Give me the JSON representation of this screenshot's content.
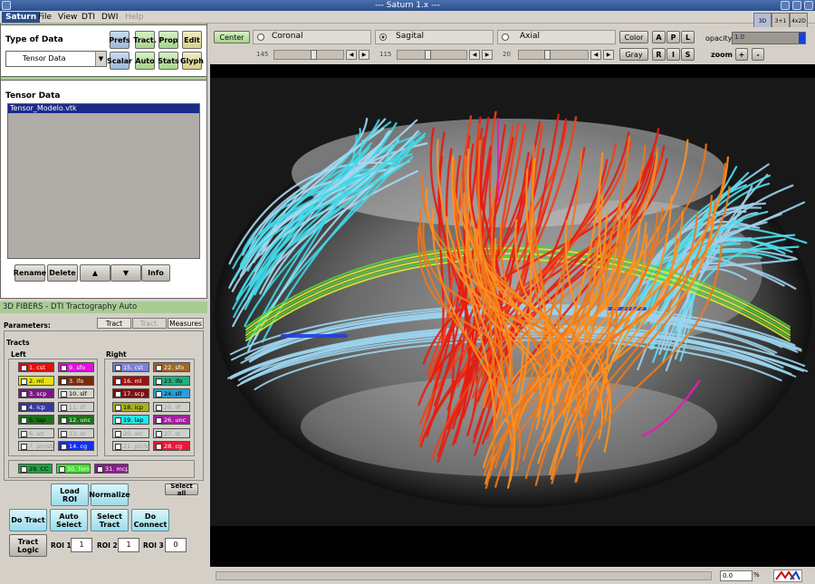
{
  "window": {
    "title": "--- Saturn 1.x ---"
  },
  "menu": [
    "Saturn",
    "File",
    "View",
    "DTI",
    "DWI",
    "Help"
  ],
  "view_buttons": [
    "3D",
    "3+1",
    "4x2D"
  ],
  "type_of_data": {
    "title": "Type of Data",
    "select_value": "Tensor Data",
    "buttons": [
      "Prefs",
      "Tract.",
      "Prop",
      "Edit",
      "Scalar",
      "Auto",
      "Stats",
      "Glyph"
    ]
  },
  "tensor_data": {
    "title": "Tensor Data",
    "items": [
      "Tensor_Modelo.vtk"
    ],
    "buttons": [
      "Rename",
      "Delete",
      "▲",
      "▼",
      "Info"
    ]
  },
  "fibers": {
    "header": "3D FIBERS - DTI Tractography Auto",
    "params_label": "Parameters:",
    "tabs": [
      "Tract",
      "Tract. Auto",
      "Measures"
    ],
    "tracts_label": "Tracts",
    "left_label": "Left",
    "right_label": "Right",
    "left_tracts": [
      {
        "label": "1. cst",
        "color": "#e01010",
        "text": "#fff"
      },
      {
        "label": "9. sfo",
        "color": "#e010e0",
        "text": "#fff"
      },
      {
        "label": "2. ml",
        "color": "#e8e010",
        "text": "#000"
      },
      {
        "label": "3. ifo",
        "color": "#7a2808",
        "text": "#fff"
      },
      {
        "label": "3. scp",
        "color": "#7a1880",
        "text": "#fff"
      },
      {
        "label": "10. slf",
        "color": "#d4d4c8",
        "text": "#000"
      },
      {
        "label": "4. icp",
        "color": "#3838a0",
        "text": "#fff"
      },
      {
        "label": "11. ilf",
        "color": "#d0d0cc",
        "text": "#999"
      },
      {
        "label": "5. lap",
        "color": "#1c7018",
        "text": "#000"
      },
      {
        "label": "12. unc",
        "color": "#1c7018",
        "text": "#fff"
      },
      {
        "label": "6. atr",
        "color": "#d0d0cc",
        "text": "#999"
      },
      {
        "label": "13. st",
        "color": "#d0d0cc",
        "text": "#999"
      },
      {
        "label": "7. ptr/str",
        "color": "#d0d0cc",
        "text": "#999"
      },
      {
        "label": "14. cg",
        "color": "#1030f0",
        "text": "#fff"
      }
    ],
    "right_tracts": [
      {
        "label": "15. cst",
        "color": "#7a82d8",
        "text": "#fff"
      },
      {
        "label": "22. sfo",
        "color": "#a06828",
        "text": "#fff"
      },
      {
        "label": "16. ml",
        "color": "#a01010",
        "text": "#fff"
      },
      {
        "label": "23. ifo",
        "color": "#20b080",
        "text": "#000"
      },
      {
        "label": "17. scp",
        "color": "#781010",
        "text": "#fff"
      },
      {
        "label": "24. slf",
        "color": "#28a0d8",
        "text": "#000"
      },
      {
        "label": "18. icp",
        "color": "#a8b020",
        "text": "#000"
      },
      {
        "label": "25. ilf",
        "color": "#d0d0cc",
        "text": "#999"
      },
      {
        "label": "19. lap",
        "color": "#20e8e8",
        "text": "#000"
      },
      {
        "label": "26. unc",
        "color": "#a020a0",
        "text": "#fff"
      },
      {
        "label": "20. atr",
        "color": "#d0d0cc",
        "text": "#999"
      },
      {
        "label": "27. st",
        "color": "#d0d0cc",
        "text": "#999"
      },
      {
        "label": "21. ptr/str",
        "color": "#d0d0cc",
        "text": "#999"
      },
      {
        "label": "28. cg",
        "color": "#e81838",
        "text": "#fff"
      }
    ],
    "common_tracts": [
      {
        "label": "29. CC",
        "color": "#20a040",
        "text": "#000"
      },
      {
        "label": "30. forn",
        "color": "#40e030",
        "text": "#fff"
      },
      {
        "label": "31. mcp",
        "color": "#8c1c8c",
        "text": "#fff"
      }
    ],
    "select_all": "Select all",
    "load_roi": "Load ROI",
    "normalize": "Normalize",
    "actions": [
      "Do Tract",
      "Auto Select",
      "Select Tract",
      "Do Connect"
    ],
    "tract_logic": "Tract Logic",
    "roi1_label": "ROI 1",
    "roi1_value": "1",
    "roi2_label": "ROI 2",
    "roi2_value": "1",
    "roi3_label": "ROI 3",
    "roi3_value": "0"
  },
  "viewer": {
    "center_btn": "Center",
    "planes": [
      {
        "label": "Coronal",
        "value": "145",
        "selected": false
      },
      {
        "label": "Sagital",
        "value": "115",
        "selected": true
      },
      {
        "label": "Axial",
        "value": "20",
        "selected": false
      }
    ],
    "color_btn": "Color",
    "gray_btn": "Gray",
    "orient": [
      "A",
      "P",
      "L",
      "R",
      "I",
      "S"
    ],
    "opacity_label": "opacity",
    "opacity_value": "1.0",
    "zoom_label": "zoom",
    "zoom_plus": "+",
    "zoom_minus": "-"
  },
  "status": {
    "value": "0.0",
    "unit": "%"
  }
}
